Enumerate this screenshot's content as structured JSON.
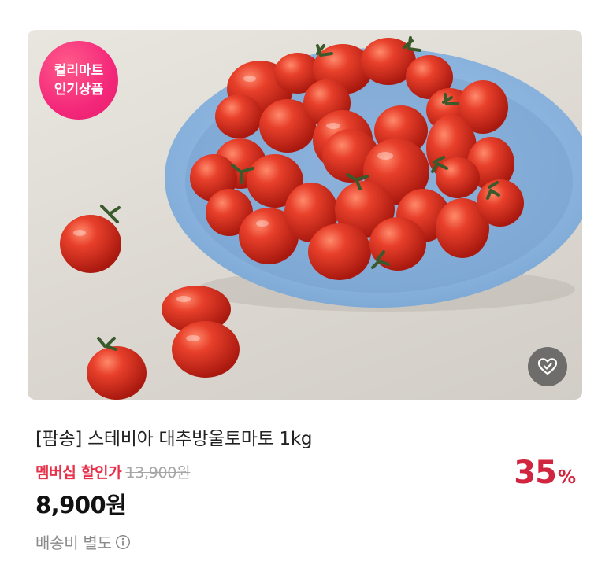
{
  "badge": {
    "line1": "컬리마트",
    "line2": "인기상품"
  },
  "product": {
    "title": "[팜송] 스테비아 대추방울토마토 1kg",
    "member_label": "멤버십 할인가",
    "original_price": "13,900원",
    "sale_price": "8,900원",
    "discount_value": "35",
    "discount_unit": "%",
    "shipping": "배송비 별도"
  },
  "icons": {
    "wishlist": "heart-check-icon",
    "info": "info-icon"
  },
  "colors": {
    "badge": "#f4287a",
    "discount": "#d0243f",
    "member_label": "#e6324b"
  }
}
